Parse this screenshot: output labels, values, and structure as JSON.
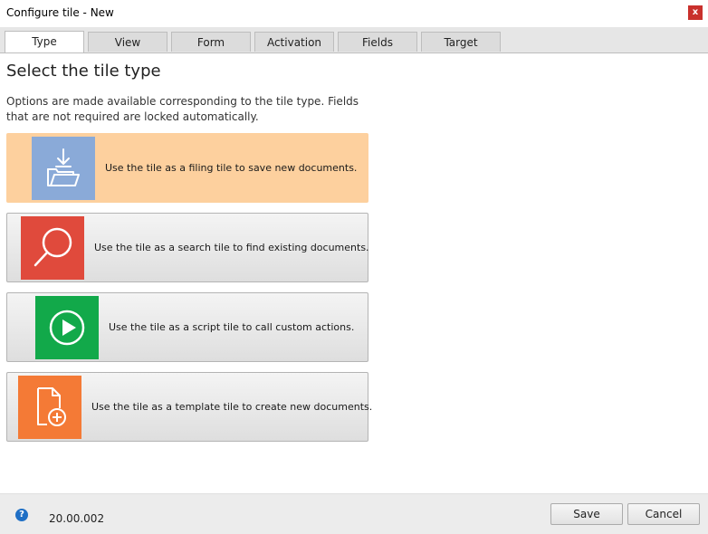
{
  "window": {
    "title": "Configure tile - New",
    "close_glyph": "x"
  },
  "tabs": [
    {
      "label": "Type",
      "active": true
    },
    {
      "label": "View",
      "active": false
    },
    {
      "label": "Form",
      "active": false
    },
    {
      "label": "Activation",
      "active": false
    },
    {
      "label": "Fields",
      "active": false
    },
    {
      "label": "Target",
      "active": false
    }
  ],
  "main": {
    "heading": "Select the tile type",
    "description": "Options are made available corresponding to the tile type. Fields that are not required are locked automatically.",
    "options": [
      {
        "label": "Use the tile as a filing tile to save new documents.",
        "icon": "folder-download-icon",
        "color": "#8aaad8",
        "selected": true
      },
      {
        "label": "Use the tile as a search tile to find existing documents.",
        "icon": "magnifier-icon",
        "color": "#e04a3c",
        "selected": false
      },
      {
        "label": "Use the tile as a script tile to call custom actions.",
        "icon": "play-icon",
        "color": "#12a94a",
        "selected": false
      },
      {
        "label": "Use the tile as a template tile to create new documents.",
        "icon": "document-add-icon",
        "color": "#f47a36",
        "selected": false
      }
    ]
  },
  "footer": {
    "help_glyph": "?",
    "version": "20.00.002",
    "save_label": "Save",
    "cancel_label": "Cancel"
  },
  "colors": {
    "selected_background": "#fdd09e",
    "close_button": "#c9302c",
    "help_icon": "#1f6fc5"
  }
}
